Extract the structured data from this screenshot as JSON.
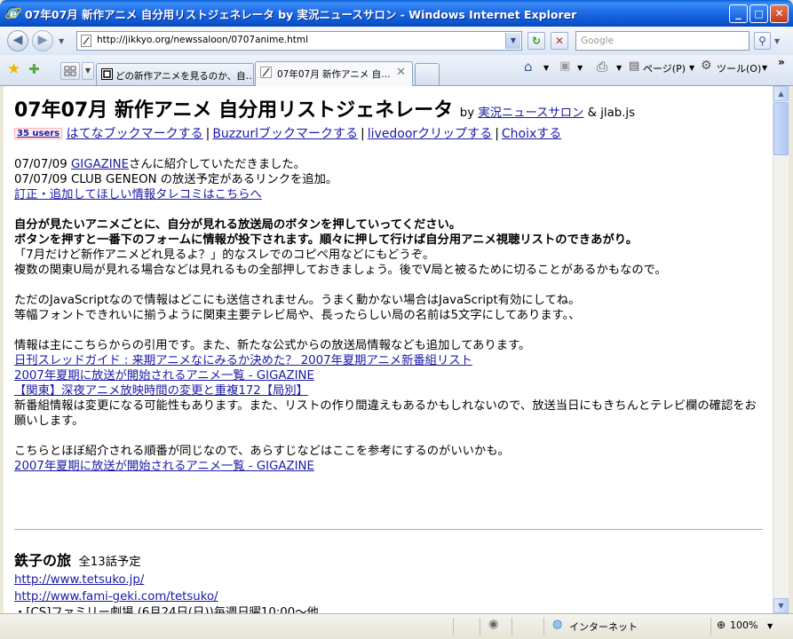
{
  "window": {
    "title": "07年07月 新作アニメ 自分用リストジェネレータ by 実況ニュースサロン - Windows Internet Explorer",
    "min": "_",
    "max": "□",
    "close": "✕"
  },
  "nav": {
    "back": "◀",
    "forward": "▶",
    "address": "http://jikkyo.org/newssaloon/0707anime.html",
    "search_placeholder": "Google",
    "refresh": "↻",
    "stop": "✕",
    "search_btn": "⚲"
  },
  "tabs": [
    {
      "label": "どの新作アニメを見るのか、自…",
      "active": false
    },
    {
      "label": "07年07月 新作アニメ 自…",
      "active": true
    }
  ],
  "toolbar": {
    "page_menu": "ページ(P)",
    "tools_menu": "ツール(O)"
  },
  "page": {
    "title": "07年07月 新作アニメ 自分用リストジェネレータ",
    "by": "by",
    "by_link": "実況ニュースサロン",
    "by_tail": "& jlab.js",
    "users_badge": "35 users",
    "bookmarks": [
      "はてなブックマークする",
      "Buzzurlブックマークする",
      "livedoorクリップする",
      "Choixする"
    ],
    "news1_date": "07/07/09",
    "news1_link": "GIGAZINE",
    "news1_tail": "さんに紹介していただきました。",
    "news2": "07/07/09 CLUB GENEON の放送予定があるリンクを追加。",
    "correction_link": "訂正・追加してほしい情報タレコミはこちらへ",
    "bold1": "自分が見たいアニメごとに、自分が見れる放送局のボタンを押していってください。",
    "bold2": "ボタンを押すと一番下のフォームに情報が投下されます。順々に押して行けば自分用アニメ視聴リストのできあがり。",
    "line1": "「7月だけど新作アニメどれ見るよ？」的なスレでのコピペ用などにもどうぞ。",
    "line2": "複数の関東U局が見れる場合などは見れるもの全部押しておきましょう。後でV局と被るために切ることがあるかもなので。",
    "js1": "ただのJavaScriptなので情報はどこにも送信されません。うまく動かない場合はJavaScript有効にしてね。",
    "js2": "等幅フォントできれいに揃うように関東主要テレビ局や、長ったらしい局の名前は5文字にしてあります。、",
    "info_intro": "情報は主にこちらからの引用です。また、新たな公式からの放送局情報なども追加してあります。",
    "src1": "日刊スレッドガイド : 来期アニメなにみるか決めた？ 2007年夏期アニメ新番組リスト",
    "src2": "2007年夏期に放送が開始されるアニメ一覧 - GIGAZINE",
    "src3": "【関東】深夜アニメ放映時間の変更と重複172【局別】",
    "warn": "新番組情報は変更になる可能性もあります。また、リストの作り間違えもあるかもしれないので、放送当日にもきちんとテレビ欄の確認をお願いします。",
    "order": "こちらとほぼ紹介される順番が同じなので、あらすじなどはここを参考にするのがいいかも。",
    "order_link": "2007年夏期に放送が開始されるアニメ一覧 - GIGAZINE"
  },
  "show": {
    "title": "鉄子の旅",
    "count": "全13話予定",
    "link1": "http://www.tetsuko.jp/",
    "link2": "http://www.fami-geki.com/tetsuko/",
    "partial": "・[CS]ファミリー劇場 (6月24日(日))毎週日曜10:00〜他"
  },
  "status": {
    "zone": "インターネット",
    "zoom": "100%"
  }
}
